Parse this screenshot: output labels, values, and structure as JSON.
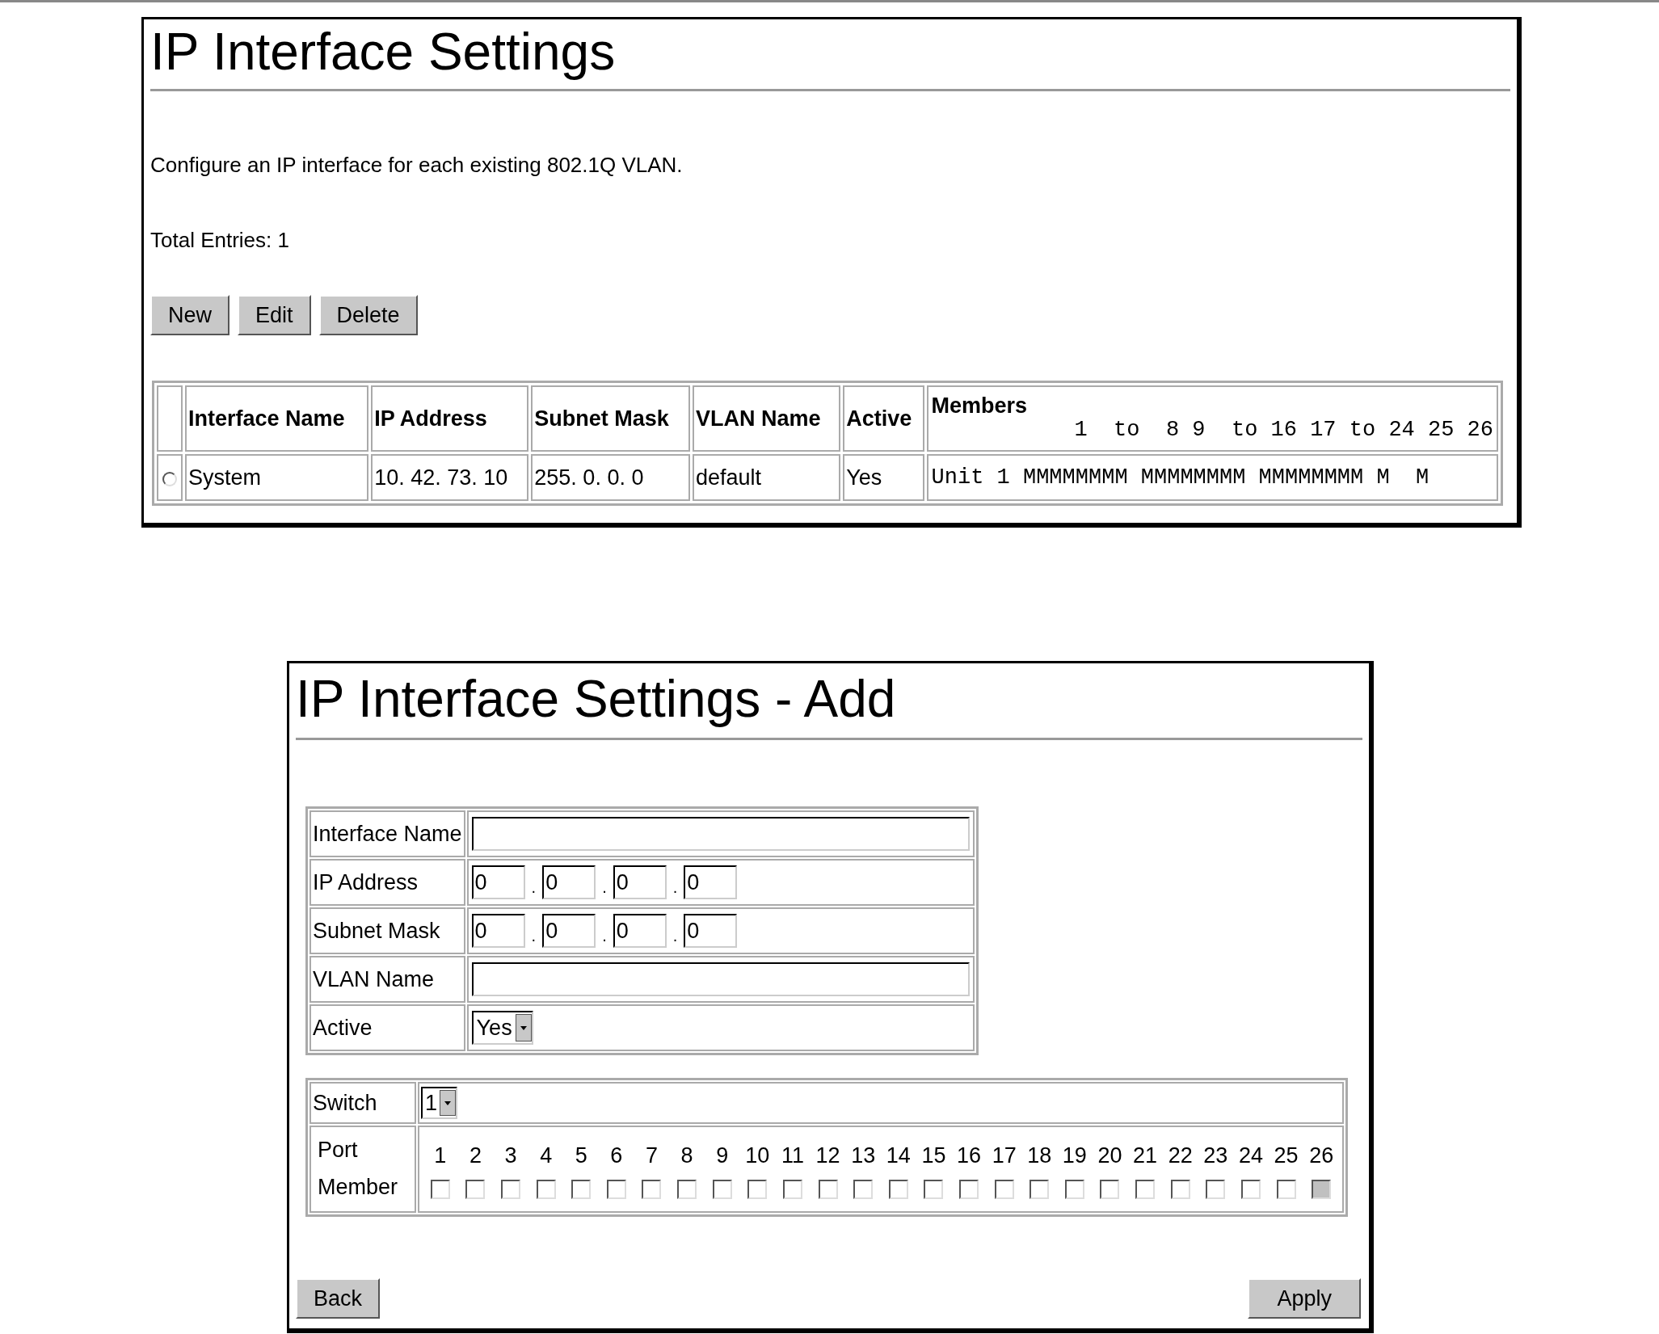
{
  "list_page": {
    "title": "IP Interface Settings",
    "description": "Configure an IP interface for each existing 802.1Q VLAN.",
    "total_entries": "Total Entries: 1",
    "buttons": [
      "New",
      "Edit",
      "Delete"
    ],
    "table": {
      "columns": [
        "Interface Name",
        "IP Address",
        "Subnet Mask",
        "VLAN Name",
        "Active"
      ],
      "members_heading": "Members",
      "members_ports": "1  to  8 9  to 16 17 to 24 25 26",
      "rows": [
        {
          "selected": false,
          "cells": [
            "System",
            "10. 42. 73. 10",
            "255. 0. 0. 0",
            "default",
            "Yes"
          ],
          "members": "Unit 1 MMMMMMMM MMMMMMMM MMMMMMMM M  M"
        }
      ]
    }
  },
  "add_page": {
    "title": "IP Interface Settings - Add",
    "fields": [
      {
        "label": "Interface Name",
        "kind": "text"
      },
      {
        "label": "IP Address",
        "kind": "ip",
        "octets": [
          "0",
          "0",
          "0",
          "0"
        ],
        "separators": [
          ".",
          ".",
          "."
        ]
      },
      {
        "label": "Subnet Mask",
        "kind": "ip",
        "octets": [
          "0",
          "0",
          "0",
          "0"
        ],
        "separators": [
          ".",
          ".",
          "."
        ]
      },
      {
        "label": "VLAN Name",
        "kind": "text"
      },
      {
        "label": "Active",
        "kind": "select",
        "value": "Yes"
      }
    ],
    "switch": {
      "label": "Switch",
      "value": "1"
    },
    "port_label": [
      "Port",
      "Member"
    ],
    "ports": [
      {
        "label": "1",
        "checked": false,
        "disabled": false
      },
      {
        "label": "2",
        "checked": false,
        "disabled": false
      },
      {
        "label": "3",
        "checked": false,
        "disabled": false
      },
      {
        "label": "4",
        "checked": false,
        "disabled": false
      },
      {
        "label": "5",
        "checked": false,
        "disabled": false
      },
      {
        "label": "6",
        "checked": false,
        "disabled": false
      },
      {
        "label": "7",
        "checked": false,
        "disabled": false
      },
      {
        "label": "8",
        "checked": false,
        "disabled": false
      },
      {
        "label": "9",
        "checked": false,
        "disabled": false
      },
      {
        "label": "10",
        "checked": false,
        "disabled": false
      },
      {
        "label": "11",
        "checked": false,
        "disabled": false
      },
      {
        "label": "12",
        "checked": false,
        "disabled": false
      },
      {
        "label": "13",
        "checked": false,
        "disabled": false
      },
      {
        "label": "14",
        "checked": false,
        "disabled": false
      },
      {
        "label": "15",
        "checked": false,
        "disabled": false
      },
      {
        "label": "16",
        "checked": false,
        "disabled": false
      },
      {
        "label": "17",
        "checked": false,
        "disabled": false
      },
      {
        "label": "18",
        "checked": false,
        "disabled": false
      },
      {
        "label": "19",
        "checked": false,
        "disabled": false
      },
      {
        "label": "20",
        "checked": false,
        "disabled": false
      },
      {
        "label": "21",
        "checked": false,
        "disabled": false
      },
      {
        "label": "22",
        "checked": false,
        "disabled": false
      },
      {
        "label": "23",
        "checked": false,
        "disabled": false
      },
      {
        "label": "24",
        "checked": false,
        "disabled": false
      },
      {
        "label": "25",
        "checked": false,
        "disabled": false
      },
      {
        "label": "26",
        "checked": false,
        "disabled": true
      }
    ],
    "buttons": {
      "back": "Back",
      "apply": "Apply"
    }
  }
}
